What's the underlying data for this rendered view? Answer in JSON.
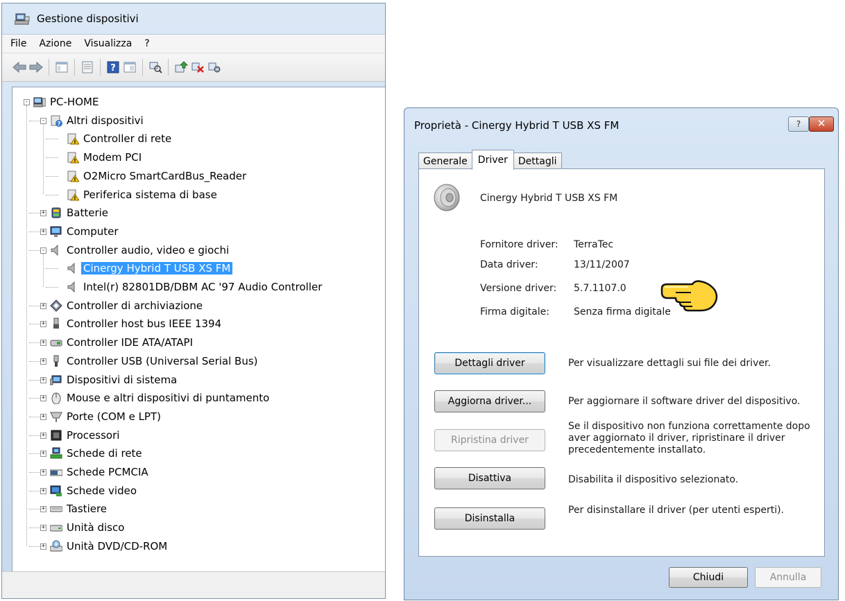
{
  "device_manager": {
    "title": "Gestione dispositivi",
    "menu": [
      "File",
      "Azione",
      "Visualizza",
      "?"
    ],
    "toolbar_icons": [
      "back-icon",
      "forward-icon",
      "show-hide-tree-icon",
      "properties-icon",
      "help-icon",
      "console-tree-icon",
      "scan-hardware-icon",
      "update-driver-icon",
      "disable-device-icon",
      "uninstall-device-icon"
    ],
    "tree": [
      {
        "label": "PC-HOME",
        "level": 0,
        "expander": "-",
        "icon": "computer-icon"
      },
      {
        "label": "Altri dispositivi",
        "level": 1,
        "expander": "-",
        "icon": "unknown-device-icon"
      },
      {
        "label": "Controller di rete",
        "level": 2,
        "icon": "warning-device-icon"
      },
      {
        "label": "Modem PCI",
        "level": 2,
        "icon": "warning-device-icon"
      },
      {
        "label": "O2Micro SmartCardBus_Reader",
        "level": 2,
        "icon": "warning-device-icon"
      },
      {
        "label": "Periferica sistema di base",
        "level": 2,
        "icon": "warning-device-icon"
      },
      {
        "label": "Batterie",
        "level": 1,
        "expander": "+",
        "icon": "battery-icon"
      },
      {
        "label": "Computer",
        "level": 1,
        "expander": "+",
        "icon": "monitor-icon"
      },
      {
        "label": "Controller audio, video e giochi",
        "level": 1,
        "expander": "-",
        "icon": "speaker-icon"
      },
      {
        "label": "Cinergy Hybrid T USB XS FM",
        "level": 2,
        "icon": "speaker-icon",
        "selected": true
      },
      {
        "label": "Intel(r) 82801DB/DBM AC '97 Audio Controller",
        "level": 2,
        "icon": "speaker-icon"
      },
      {
        "label": "Controller di archiviazione",
        "level": 1,
        "expander": "+",
        "icon": "storage-controller-icon"
      },
      {
        "label": "Controller host bus IEEE 1394",
        "level": 1,
        "expander": "+",
        "icon": "ieee1394-icon"
      },
      {
        "label": "Controller IDE ATA/ATAPI",
        "level": 1,
        "expander": "+",
        "icon": "ide-controller-icon"
      },
      {
        "label": "Controller USB (Universal Serial Bus)",
        "level": 1,
        "expander": "+",
        "icon": "usb-icon"
      },
      {
        "label": "Dispositivi di sistema",
        "level": 1,
        "expander": "+",
        "icon": "system-device-icon"
      },
      {
        "label": "Mouse e altri dispositivi di puntamento",
        "level": 1,
        "expander": "+",
        "icon": "mouse-icon"
      },
      {
        "label": "Porte (COM e LPT)",
        "level": 1,
        "expander": "+",
        "icon": "port-icon"
      },
      {
        "label": "Processori",
        "level": 1,
        "expander": "+",
        "icon": "processor-icon"
      },
      {
        "label": "Schede di rete",
        "level": 1,
        "expander": "+",
        "icon": "network-card-icon"
      },
      {
        "label": "Schede PCMCIA",
        "level": 1,
        "expander": "+",
        "icon": "pcmcia-icon"
      },
      {
        "label": "Schede video",
        "level": 1,
        "expander": "+",
        "icon": "display-adapter-icon"
      },
      {
        "label": "Tastiere",
        "level": 1,
        "expander": "+",
        "icon": "keyboard-icon"
      },
      {
        "label": "Unità disco",
        "level": 1,
        "expander": "+",
        "icon": "disk-drive-icon"
      },
      {
        "label": "Unità DVD/CD-ROM",
        "level": 1,
        "expander": "+",
        "icon": "dvd-drive-icon"
      }
    ]
  },
  "dialog": {
    "title": "Proprietà - Cinergy Hybrid T USB XS FM",
    "help_label": "?",
    "close_label": "✕",
    "tabs": [
      "Generale",
      "Driver",
      "Dettagli"
    ],
    "active_tab": "Driver",
    "device_name": "Cinergy Hybrid T USB XS FM",
    "fields": [
      {
        "label": "Fornitore driver:",
        "value": "TerraTec"
      },
      {
        "label": "Data driver:",
        "value": "13/11/2007"
      },
      {
        "label": "Versione driver:",
        "value": "5.7.1107.0"
      },
      {
        "label": "Firma digitale:",
        "value": "Senza firma digitale"
      }
    ],
    "actions": [
      {
        "button": "Dettagli driver",
        "description": "Per visualizzare dettagli sui file dei driver.",
        "enabled": true,
        "default": true
      },
      {
        "button": "Aggiorna driver...",
        "description": "Per aggiornare il software driver del dispositivo.",
        "enabled": true
      },
      {
        "button": "Ripristina driver",
        "description": "Se il dispositivo non funziona correttamente dopo aver aggiornato il driver, ripristinare il driver precedentemente installato.",
        "enabled": false
      },
      {
        "button": "Disattiva",
        "description": "Disabilita il dispositivo selezionato.",
        "enabled": true
      },
      {
        "button": "Disinstalla",
        "description": "Per disinstallare il driver (per utenti esperti).",
        "enabled": true
      }
    ],
    "ok_label": "Chiudi",
    "cancel_label": "Annulla",
    "colors": {
      "selection": "#3399ff",
      "dialog_frame": "#c6d8ee",
      "close_button": "#c4452a"
    }
  }
}
